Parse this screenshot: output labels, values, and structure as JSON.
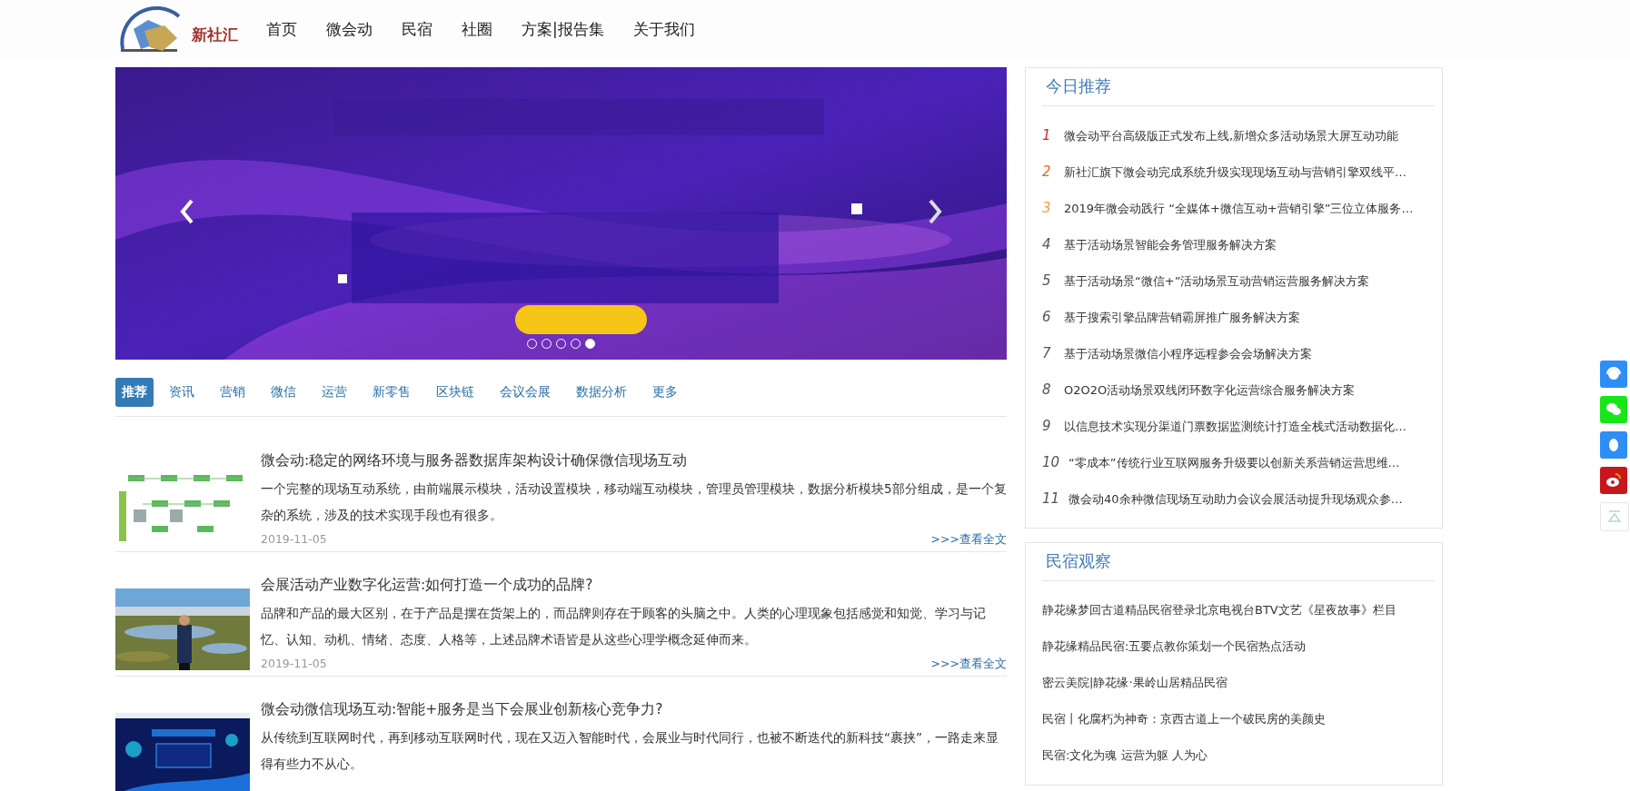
{
  "logo": {
    "text": "新社汇"
  },
  "nav": [
    {
      "label": "首页"
    },
    {
      "label": "微会动"
    },
    {
      "label": "民宿"
    },
    {
      "label": "社圈"
    },
    {
      "label": "方案|报告集"
    },
    {
      "label": "关于我们"
    }
  ],
  "carousel": {
    "slides": [
      {
        "selected": false
      },
      {
        "selected": false
      },
      {
        "selected": false
      },
      {
        "selected": false
      },
      {
        "selected": true
      }
    ]
  },
  "tabs": [
    {
      "label": "推荐",
      "selected": true
    },
    {
      "label": "资讯",
      "selected": false
    },
    {
      "label": "营销",
      "selected": false
    },
    {
      "label": "微信",
      "selected": false
    },
    {
      "label": "运营",
      "selected": false
    },
    {
      "label": "新零售",
      "selected": false
    },
    {
      "label": "区块链",
      "selected": false
    },
    {
      "label": "会议会展",
      "selected": false
    },
    {
      "label": "数据分析",
      "selected": false
    },
    {
      "label": "更多",
      "selected": false
    }
  ],
  "articles": [
    {
      "title": "微会动:稳定的网络环境与服务器数据库架构设计确保微信现场互动",
      "summary": "一个完整的现场互动系统，由前端展示模块，活动设置模块，移动端互动模块，管理员管理模块，数据分析模块5部分组成，是一个复杂的系统，涉及的技术实现手段也有很多。",
      "date": "2019-11-05",
      "more": ">>>查看全文"
    },
    {
      "title": "会展活动产业数字化运营:如何打造一个成功的品牌?",
      "summary": "品牌和产品的最大区别，在于产品是摆在货架上的，而品牌则存在于顾客的头脑之中。人类的心理现象包括感觉和知觉、学习与记忆、认知、动机、情绪、态度、人格等，上述品牌术语皆是从这些心理学概念延伸而来。",
      "date": "2019-11-05",
      "more": ">>>查看全文"
    },
    {
      "title": "微会动微信现场互动:智能+服务是当下会展业创新核心竞争力?",
      "summary": "从传统到互联网时代，再到移动互联网时代，现在又迈入智能时代，会展业与时代同行，也被不断迭代的新科技“裹挟”，一路走来显得有些力不从心。"
    }
  ],
  "today": {
    "title": "今日推荐",
    "items": [
      {
        "rank": "1",
        "color": "#d9261c",
        "text": "微会动平台高级版正式发布上线,新增众多活动场景大屏互动功能"
      },
      {
        "rank": "2",
        "color": "#e8671c",
        "text": "新社汇旗下微会动完成系统升级实现现场互动与营销引擎双线平…"
      },
      {
        "rank": "3",
        "color": "#f0a030",
        "text": "2019年微会动践行 “全媒体+微信互动+营销引擎”三位立体服务…"
      },
      {
        "rank": "4",
        "color": "#555555",
        "text": "基于活动场景智能会务管理服务解决方案"
      },
      {
        "rank": "5",
        "color": "#555555",
        "text": "基于活动场景“微信+”活动场景互动营销运营服务解决方案"
      },
      {
        "rank": "6",
        "color": "#555555",
        "text": "基于搜索引擎品牌营销霸屏推广服务解决方案"
      },
      {
        "rank": "7",
        "color": "#555555",
        "text": "基于活动场景微信小程序远程参会会场解决方案"
      },
      {
        "rank": "8",
        "color": "#555555",
        "text": "O2O2O活动场景双线闭环数字化运营综合服务解决方案"
      },
      {
        "rank": "9",
        "color": "#555555",
        "text": "以信息技术实现分渠道门票数据监测统计打造全栈式活动数据化…"
      },
      {
        "rank": "10",
        "color": "#555555",
        "text": "“零成本”传统行业互联网服务升级要以创新关系营销运营思维…"
      },
      {
        "rank": "11",
        "color": "#555555",
        "text": "微会动40余种微信现场互动助力会议会展活动提升现场观众参…"
      }
    ]
  },
  "homestay": {
    "title": "民宿观察",
    "items": [
      {
        "text": "静花缘梦回古道精品民宿登录北京电视台BTV文艺《星夜故事》栏目"
      },
      {
        "text": "静花缘精品民宿:五要点教你策划一个民宿热点活动"
      },
      {
        "text": "密云美院|静花缘·果岭山居精品民宿"
      },
      {
        "text": "民宿丨化腐朽为神奇：京西古道上一个破民房的美颜史"
      },
      {
        "text": "民宿:文化为魂 运营为躯 人为心"
      }
    ]
  },
  "float_buttons": [
    {
      "kind": "support"
    },
    {
      "kind": "wechat"
    },
    {
      "kind": "qq"
    },
    {
      "kind": "weibo"
    },
    {
      "kind": "top"
    }
  ]
}
